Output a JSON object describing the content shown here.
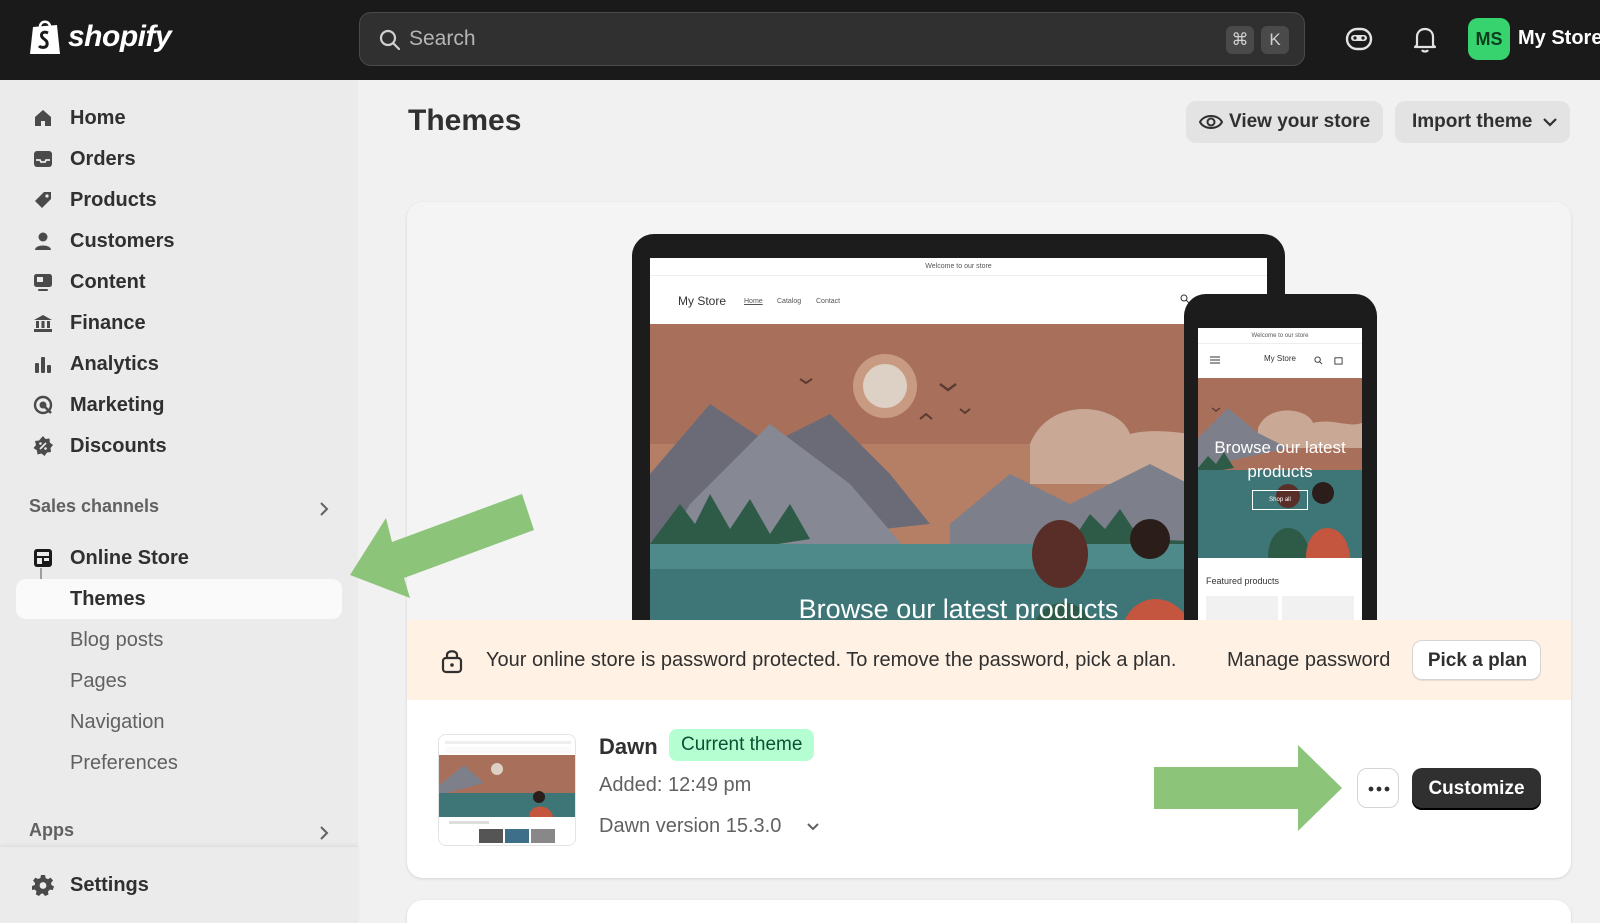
{
  "topbar": {
    "brand": "shopify",
    "search_placeholder": "Search",
    "shortcut_cmd": "⌘",
    "shortcut_key": "K",
    "avatar_initials": "MS",
    "store_name": "My Store"
  },
  "sidebar": {
    "items": [
      {
        "label": "Home",
        "icon": "home-icon"
      },
      {
        "label": "Orders",
        "icon": "inbox-icon"
      },
      {
        "label": "Products",
        "icon": "tag-icon"
      },
      {
        "label": "Customers",
        "icon": "person-icon"
      },
      {
        "label": "Content",
        "icon": "content-icon"
      },
      {
        "label": "Finance",
        "icon": "bank-icon"
      },
      {
        "label": "Analytics",
        "icon": "bar-chart-icon"
      },
      {
        "label": "Marketing",
        "icon": "target-icon"
      },
      {
        "label": "Discounts",
        "icon": "discount-icon"
      }
    ],
    "sales_channels_title": "Sales channels",
    "online_store": "Online Store",
    "online_store_subitems": [
      "Themes",
      "Blog posts",
      "Pages",
      "Navigation",
      "Preferences"
    ],
    "apps_title": "Apps",
    "settings": "Settings"
  },
  "main": {
    "title": "Themes",
    "view_store_label": "View your store",
    "import_theme_label": "Import theme",
    "preview": {
      "announcement": "Welcome to our store",
      "store_name": "My Store",
      "nav": [
        "Home",
        "Catalog",
        "Contact"
      ],
      "headline": "Browse our latest products",
      "phone_headline": "Browse our latest products",
      "shop_all": "Shop all",
      "featured": "Featured products"
    },
    "banner": {
      "message": "Your online store is password protected. To remove the password, pick a plan.",
      "manage_password": "Manage password",
      "pick_plan_label": "Pick a plan"
    },
    "theme": {
      "name": "Dawn",
      "badge": "Current theme",
      "added": "Added: 12:49 pm",
      "version": "Dawn version 15.3.0",
      "more_label": "•••",
      "customize_label": "Customize"
    }
  },
  "colors": {
    "topbar": "#1a1a1a",
    "avatar": "#36d36e",
    "badge_bg": "#b4fed2",
    "banner_bg": "#fff1e3",
    "annotation_arrow": "#8cc47a"
  }
}
